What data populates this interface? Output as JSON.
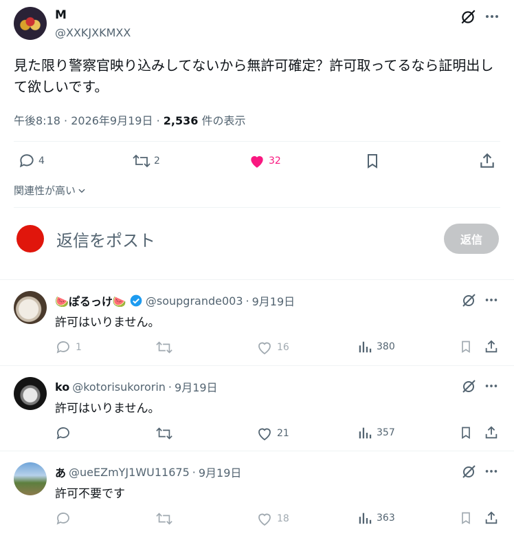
{
  "post": {
    "name": "M",
    "handle": "@XXKJXKMXX",
    "text": "見た限り警察官映り込みしてないから無許可確定？許可取ってるなら証明出して欲しいです。",
    "time": "午後8:18",
    "date": "2026年9月19日",
    "views": "2,536",
    "views_label": "件の表示",
    "replies": "4",
    "reposts": "2",
    "likes": "32",
    "like_color": "#f91880"
  },
  "sort": {
    "label": "関連性が高い"
  },
  "composer": {
    "placeholder": "返信をポスト",
    "button": "返信"
  },
  "replies": [
    {
      "name": "🍉ぽるっけ🍉",
      "verified": true,
      "handle": "@soupgrande003",
      "date": "9月19日",
      "text": "許可はいりません。",
      "replies": "1",
      "reposts": "",
      "likes": "16",
      "views": "380"
    },
    {
      "name": "ko",
      "verified": false,
      "handle": "@kotorisukororin",
      "date": "9月19日",
      "text": "許可はいりません。",
      "replies": "",
      "reposts": "",
      "likes": "21",
      "views": "357"
    },
    {
      "name": "あ",
      "verified": false,
      "handle": "@ueEZmYJ1WU11675",
      "date": "9月19日",
      "text": "許可不要です",
      "replies": "",
      "reposts": "",
      "likes": "18",
      "views": "363"
    }
  ],
  "icons": {
    "reply": "reply-bubble-icon",
    "repost": "repost-arrows-icon",
    "like": "heart-icon",
    "bookmark": "bookmark-icon",
    "share": "share-upload-icon",
    "views": "bar-chart-icon",
    "grok": "grok-icon",
    "more": "more-dots-icon"
  },
  "colors": {
    "accent": "#1d9bf0",
    "text": "#0f1419",
    "muted": "#536471"
  }
}
